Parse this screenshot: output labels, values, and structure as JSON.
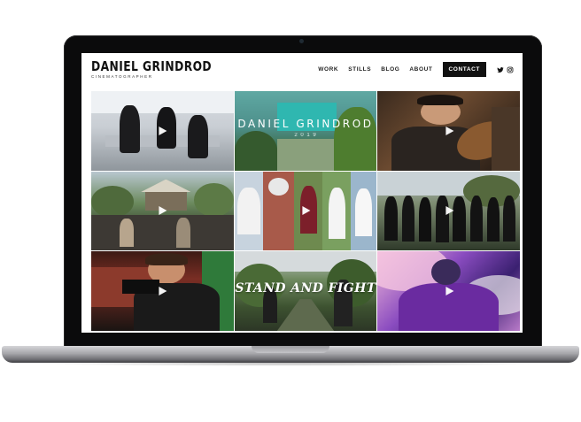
{
  "site": {
    "brand": "DANIEL GRINDROD",
    "tagline": "CINEMATOGRAPHER",
    "nav": [
      "WORK",
      "STILLS",
      "BLOG",
      "ABOUT"
    ],
    "contact_label": "CONTACT",
    "social": [
      "twitter-icon",
      "instagram-icon"
    ]
  },
  "tiles": [
    {
      "overlay": ""
    },
    {
      "overlay": "DANIEL GRINDROD",
      "overlay_sub": "2 0 1 9"
    },
    {
      "overlay": ""
    },
    {
      "overlay": ""
    },
    {
      "overlay": ""
    },
    {
      "overlay": ""
    },
    {
      "overlay": ""
    },
    {
      "overlay": "STAND AND FIGHT"
    },
    {
      "overlay": ""
    }
  ],
  "colors": {
    "accent": "#111111",
    "background": "#ffffff"
  }
}
